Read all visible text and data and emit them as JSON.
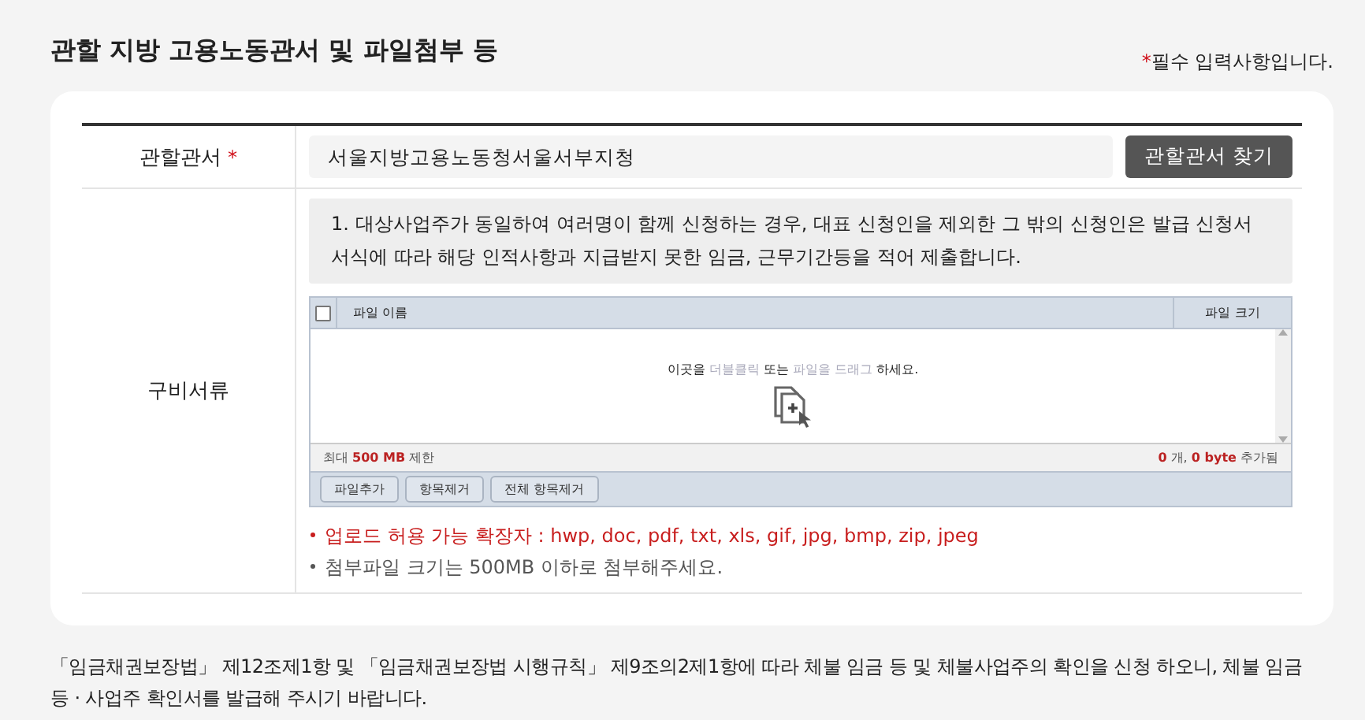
{
  "section_title": "관할 지방 고용노동관서 및 파일첨부 등",
  "required_note": {
    "mark": "*",
    "text": "필수 입력사항입니다."
  },
  "office_row": {
    "label": "관할관서",
    "required": true,
    "value": "서울지방고용노동청서울서부지청",
    "button": "관할관서 찾기"
  },
  "documents_row": {
    "label": "구비서류",
    "notice": "1. 대상사업주가 동일하여 여러명이 함께 신청하는 경우, 대표 신청인을 제외한 그 밖의 신청인은 발급 신청서 서식에 따라 해당 인적사항과 지급받지 못한 임금, 근무기간등을 적어 제출합니다.",
    "uploader": {
      "select_all_checked": false,
      "columns": [
        "파일 이름",
        "파일 크기"
      ],
      "drop_message": [
        {
          "text": "이곳을 ",
          "kind": "plain"
        },
        {
          "text": "더블클릭",
          "kind": "hint"
        },
        {
          "text": " 또는 ",
          "kind": "plain"
        },
        {
          "text": "파일을 드래그",
          "kind": "hint"
        },
        {
          "text": " 하세요.",
          "kind": "plain"
        }
      ],
      "limit": [
        {
          "text": "최대 ",
          "kind": "plain"
        },
        {
          "text": "500 MB",
          "kind": "accent"
        },
        {
          "text": " 제한",
          "kind": "plain"
        }
      ],
      "count": [
        {
          "text": "0",
          "kind": "accent"
        },
        {
          "text": " 개, ",
          "kind": "plain"
        },
        {
          "text": "0 byte",
          "kind": "accent"
        },
        {
          "text": " 추가됨",
          "kind": "plain"
        }
      ],
      "buttons": [
        "파일추가",
        "항목제거",
        "전체 항목제거"
      ]
    },
    "notes": [
      {
        "text": "업로드 허용 가능 확장자 : hwp, doc, pdf, txt, xls, gif, jpg, bmp, zip, jpeg",
        "kind": "warning"
      },
      {
        "text": "첨부파일 크기는 500MB 이하로 첨부해주세요.",
        "kind": "info"
      }
    ]
  },
  "statement": "「임금채권보장법」 제12조제1항 및 「임금채권보장법 시행규칙」 제9조의2제1항에 따라 체불 임금 등 및 체불사업주의 확인을 신청 하오니, 체불 임금 등 · 사업주 확인서를 발급해 주시기 바랍니다."
}
